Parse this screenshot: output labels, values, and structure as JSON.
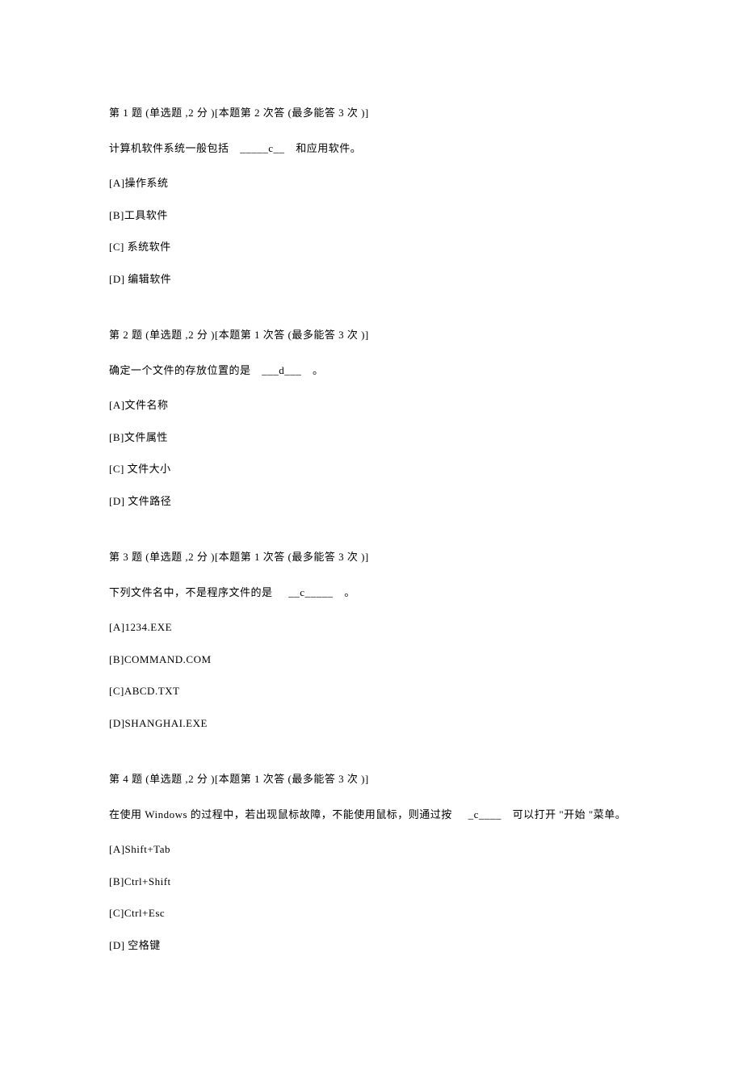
{
  "questions": [
    {
      "header": "第 1 题 (单选题 ,2 分 )[本题第  2 次答 (最多能答  3 次 )]",
      "stem_pre": "计算机软件系统一般包括",
      "stem_blank": "_____c__",
      "stem_post": "和应用软件。",
      "options": [
        "[A]操作系统",
        "[B]工具软件",
        "[C] 系统软件",
        "[D] 编辑软件"
      ]
    },
    {
      "header": "第 2 题 (单选题 ,2 分 )[本题第  1 次答 (最多能答  3 次 )]",
      "stem_pre": "确定一个文件的存放位置的是",
      "stem_blank": "___d___",
      "stem_post": "。",
      "options": [
        "[A]文件名称",
        "[B]文件属性",
        "[C] 文件大小",
        "[D] 文件路径"
      ]
    },
    {
      "header": "第 3 题 (单选题 ,2 分 )[本题第  1 次答 (最多能答  3 次 )]",
      "stem_pre": "下列文件名中，不是程序文件的是",
      "stem_blank": "__c_____",
      "stem_post": "。",
      "options": [
        "[A]1234.EXE",
        "[B]COMMAND.COM",
        "[C]ABCD.TXT",
        "[D]SHANGHAI.EXE"
      ]
    },
    {
      "header": "第 4 题 (单选题 ,2 分 )[本题第  1 次答 (最多能答  3 次 )]",
      "stem_pre": "在使用 Windows   的过程中，若出现鼠标故障，不能使用鼠标，则通过按",
      "stem_blank": "_c____",
      "stem_post": "可以打开 \"开始 \"菜单。",
      "options": [
        "[A]Shift+Tab",
        "[B]Ctrl+Shift",
        "[C]Ctrl+Esc",
        "[D] 空格键"
      ]
    }
  ]
}
